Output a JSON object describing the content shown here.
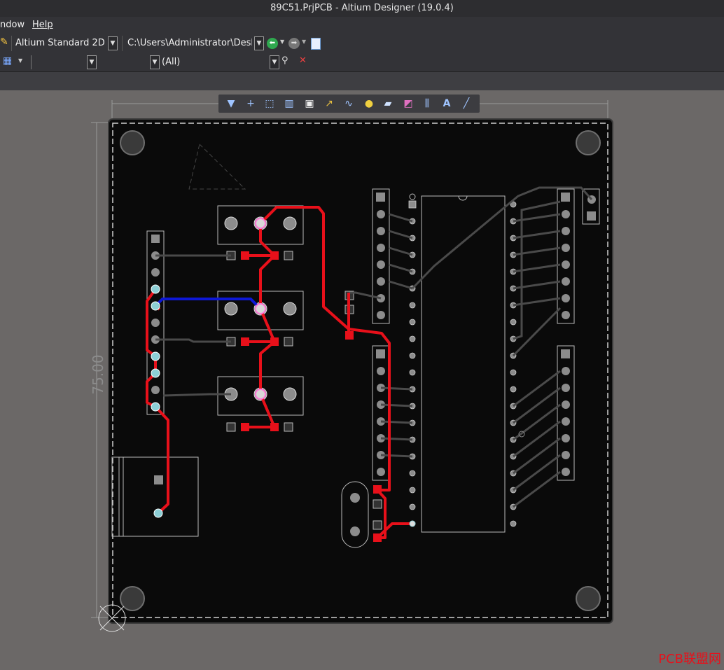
{
  "window": {
    "title": "89C51.PrjPCB - Altium Designer (19.0.4)"
  },
  "menu": {
    "items": [
      "ndow",
      "Help"
    ]
  },
  "toolbar": {
    "view_mode": "Altium Standard 2D",
    "path": "C:\\Users\\Administrator\\Deskto",
    "filter_value": "(All)"
  },
  "pcb_toolbar": {
    "tools": [
      "filter-icon",
      "place-icon",
      "select-rect-icon",
      "chart-icon",
      "component-icon",
      "interactive-route-icon",
      "diff-pair-icon",
      "via-icon",
      "polygon-icon",
      "region-icon",
      "layer-stack-icon",
      "text-icon",
      "line-icon"
    ]
  },
  "board": {
    "dimension_label": "75.00"
  },
  "watermark": "PCB联盟网",
  "colors": {
    "board": "#0a0a0a",
    "top_track": "#e8101a",
    "bottom_track": "#0e18d6",
    "outline": "#bfbfbf",
    "pad": "#8c8c8c"
  }
}
